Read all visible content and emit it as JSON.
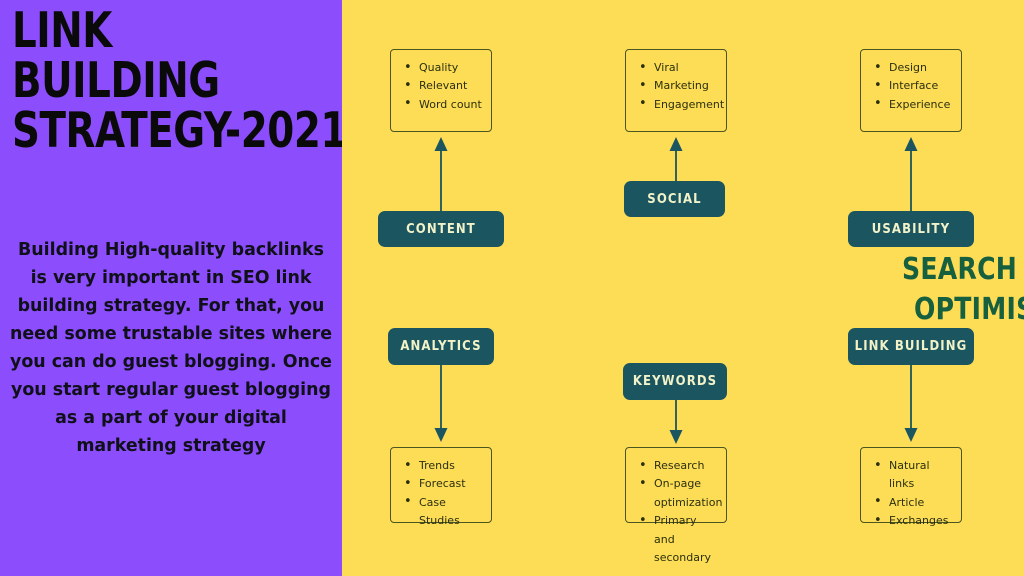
{
  "left": {
    "headline_lines": [
      "LINK",
      "BUILDING",
      "STRATEGY-2021"
    ],
    "body_text": "Building High-quality backlinks is very important in SEO link building strategy. For that, you need some trustable sites where you can do guest blogging. Once you start regular guest blogging as a part of your digital marketing strategy",
    "background_color": "#8C4DFC",
    "text_color": "#10101A"
  },
  "right": {
    "background_color": "#FDDC56",
    "center_title_lines": [
      "SEARCH ENGINE",
      "OPTIMISATION"
    ],
    "center_title_color": "#17603F",
    "pill_color": "#1B5560",
    "pill_text_color": "#F2F2C9",
    "box_border_color": "#4A5520",
    "box_text_color": "#2B3010",
    "branches": [
      {
        "id": "content",
        "label": "CONTENT",
        "arrow_direction": "up",
        "items": [
          "Quality",
          "Relevant",
          "Word count"
        ]
      },
      {
        "id": "social",
        "label": "SOCIAL",
        "arrow_direction": "up",
        "items": [
          "Viral",
          "Marketing",
          "Engagement"
        ]
      },
      {
        "id": "usability",
        "label": "USABILITY",
        "arrow_direction": "up",
        "items": [
          "Design",
          "Interface",
          "Experience"
        ]
      },
      {
        "id": "analytics",
        "label": "ANALYTICS",
        "arrow_direction": "down",
        "items": [
          "Trends",
          "Forecast",
          "Case Studies"
        ]
      },
      {
        "id": "keywords",
        "label": "KEYWORDS",
        "arrow_direction": "down",
        "items": [
          "Research",
          "On-page optimization",
          "Primary and secondary"
        ]
      },
      {
        "id": "link-building",
        "label": "LINK BUILDING",
        "arrow_direction": "down",
        "items": [
          "Natural links",
          "Article",
          "Exchanges"
        ]
      }
    ]
  }
}
